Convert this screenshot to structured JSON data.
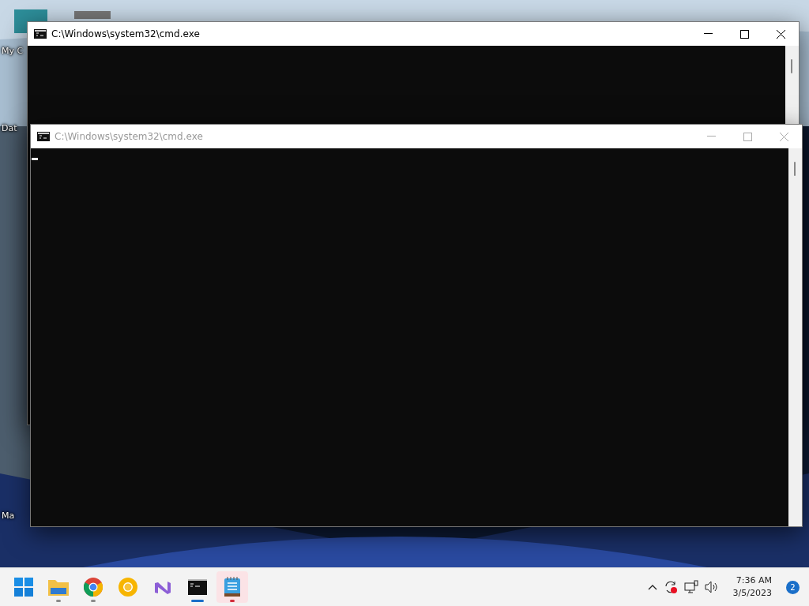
{
  "desktop_icons": [
    {
      "label": "My C"
    },
    {
      "label": "Dat"
    },
    {
      "label": "Ma"
    }
  ],
  "windows": [
    {
      "title": "C:\\Windows\\system32\\cmd.exe",
      "active": true,
      "cursor": false
    },
    {
      "title": "C:\\Windows\\system32\\cmd.exe",
      "active": false,
      "cursor": true
    }
  ],
  "taskbar": {
    "apps": [
      {
        "kind": "start",
        "running": false,
        "active": false,
        "attention": false
      },
      {
        "kind": "folder",
        "running": true,
        "active": false,
        "attention": false
      },
      {
        "kind": "chrome",
        "running": true,
        "active": false,
        "attention": false
      },
      {
        "kind": "canary",
        "running": false,
        "active": false,
        "attention": false
      },
      {
        "kind": "studio",
        "running": false,
        "active": false,
        "attention": false
      },
      {
        "kind": "terminal",
        "running": true,
        "active": true,
        "attention": false
      },
      {
        "kind": "notepad",
        "running": true,
        "active": false,
        "attention": true
      }
    ],
    "time": "7:36 AM",
    "date": "3/5/2023",
    "notifications": "2"
  }
}
